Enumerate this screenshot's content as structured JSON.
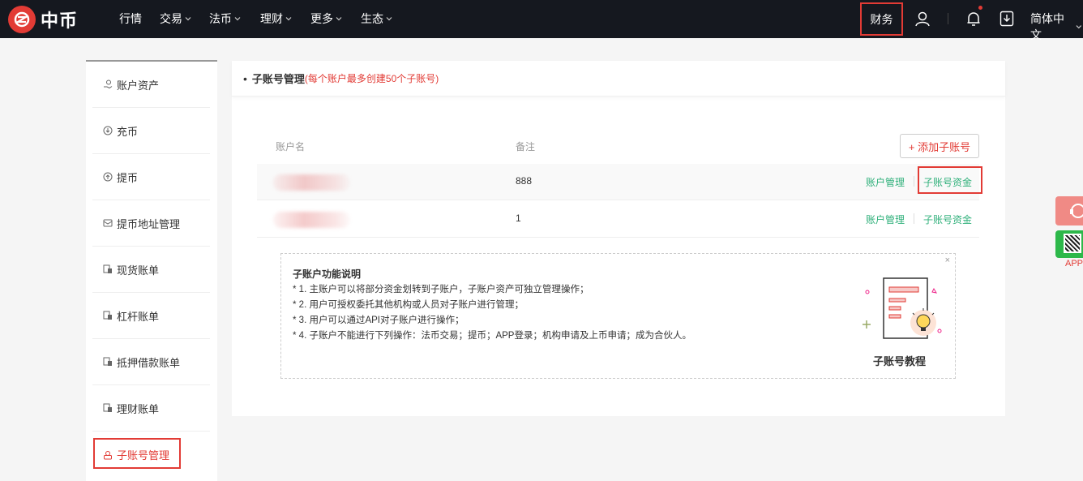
{
  "brand": {
    "name": "中币"
  },
  "nav": {
    "items": [
      {
        "label": "行情",
        "dropdown": false
      },
      {
        "label": "交易",
        "dropdown": true
      },
      {
        "label": "法币",
        "dropdown": true
      },
      {
        "label": "理财",
        "dropdown": true
      },
      {
        "label": "更多",
        "dropdown": true
      },
      {
        "label": "生态",
        "dropdown": true
      }
    ],
    "finance": "财务",
    "language": "简体中文"
  },
  "sidebar": {
    "items": [
      {
        "label": "账户资产",
        "icon": "money-hand-icon"
      },
      {
        "label": "充币",
        "icon": "deposit-icon"
      },
      {
        "label": "提币",
        "icon": "withdraw-icon"
      },
      {
        "label": "提币地址管理",
        "icon": "address-book-icon"
      },
      {
        "label": "现货账单",
        "icon": "bill-icon"
      },
      {
        "label": "杠杆账单",
        "icon": "bill-icon"
      },
      {
        "label": "抵押借款账单",
        "icon": "bill-icon"
      },
      {
        "label": "理财账单",
        "icon": "bill-icon"
      },
      {
        "label": "子账号管理",
        "icon": "sub-account-icon"
      }
    ],
    "active": "子账号管理"
  },
  "panel": {
    "title": "子账号管理",
    "subtitle": "(每个账户最多创建50个子账号)",
    "columns": {
      "name": "账户名",
      "remark": "备注"
    },
    "add_button": "+ 添加子账号",
    "rows": [
      {
        "remark": "888",
        "action1": "账户管理",
        "action2": "子账号资金"
      },
      {
        "remark": "1",
        "action1": "账户管理",
        "action2": "子账号资金"
      }
    ],
    "info": {
      "title": "子账户功能说明",
      "lines": [
        "* 1. 主账户可以将部分资金划转到子账户，子账户资产可独立管理操作；",
        "* 2. 用户可授权委托其他机构或人员对子账户进行管理；",
        "* 3. 用户可以通过API对子账户进行操作；",
        "* 4. 子账户不能进行下列操作：法币交易；提币；APP登录；机构申请及上币申请；成为合伙人。"
      ],
      "close": "×",
      "tutorial": "子账号教程"
    }
  },
  "float": {
    "app_label": "APP"
  },
  "colors": {
    "accent": "#e23b35",
    "action": "#2fb07a",
    "topbar": "#15181f"
  }
}
